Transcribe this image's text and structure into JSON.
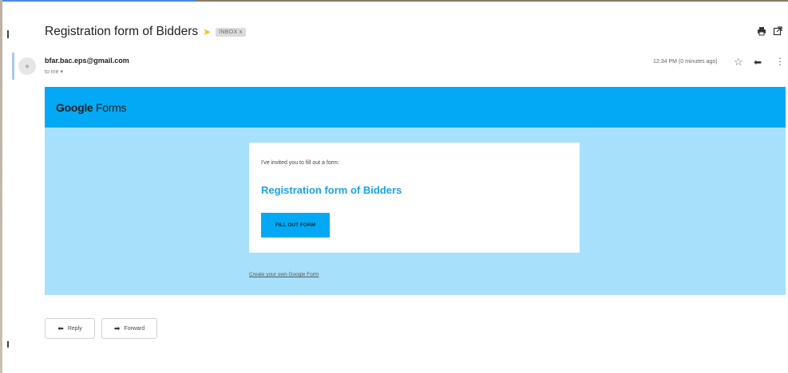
{
  "email": {
    "subject": "Registration form of Bidders",
    "label": "INBOX x",
    "sender": "bfar.bac.eps@gmail.com",
    "recipient": "to me ▾",
    "timestamp": "12:34 PM (0 minutes ago)"
  },
  "form_email": {
    "logo_word_1": "Google",
    "logo_word_2": "Forms",
    "invite_text": "I've invited you to fill out a form:",
    "form_title": "Registration form of Bidders",
    "fill_button": "FILL OUT FORM",
    "create_link": "Create your own Google Form"
  },
  "actions": {
    "reply_label": "Reply",
    "forward_label": "Forward"
  },
  "icons": {
    "importance": "importance-marker-icon",
    "print": "print-icon",
    "popout": "popout-icon",
    "avatar": "person-icon",
    "star": "star-icon",
    "reply": "reply-icon",
    "more": "more-vert-icon",
    "forward": "forward-icon"
  },
  "colors": {
    "forms_header": "#03a9f4",
    "forms_body": "#a7e0fb",
    "title_blue": "#1aa3e8"
  }
}
